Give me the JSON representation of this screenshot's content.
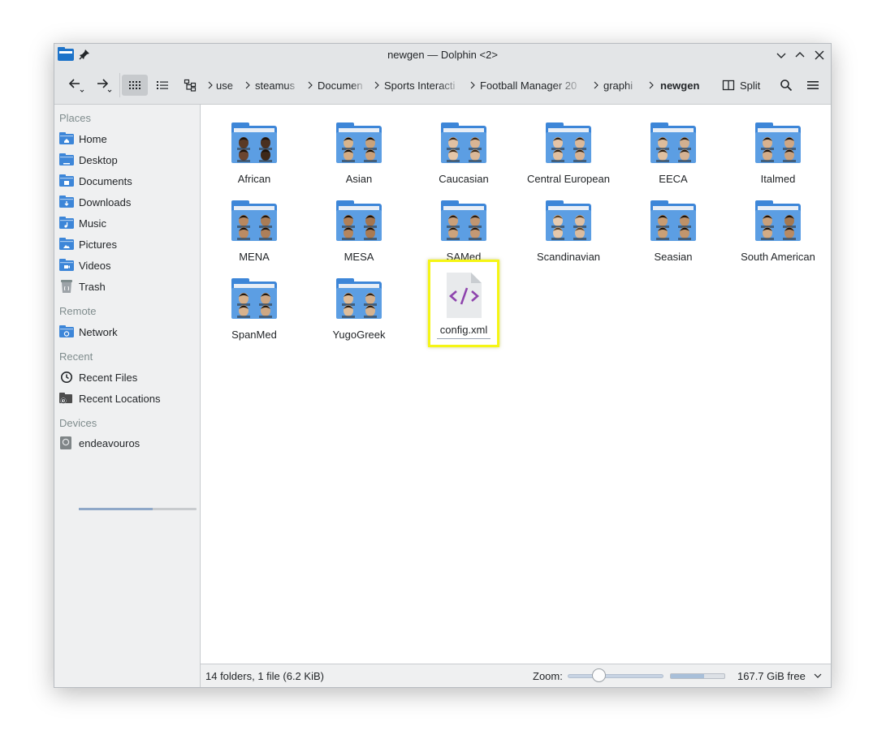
{
  "window": {
    "title": "newgen — Dolphin <2>"
  },
  "toolbar": {
    "breadcrumbs": [
      {
        "label": "use"
      },
      {
        "label": "steamus"
      },
      {
        "label": "Documen"
      },
      {
        "label": "Sports Interacti"
      },
      {
        "label": "Football Manager 20"
      },
      {
        "label": "graphi"
      },
      {
        "label": "newgen"
      }
    ],
    "split_label": "Split"
  },
  "sidebar": {
    "sections": {
      "places": "Places",
      "remote": "Remote",
      "recent": "Recent",
      "devices": "Devices"
    },
    "places": [
      {
        "label": "Home",
        "icon": "home-folder-icon"
      },
      {
        "label": "Desktop",
        "icon": "desktop-folder-icon"
      },
      {
        "label": "Documents",
        "icon": "documents-folder-icon"
      },
      {
        "label": "Downloads",
        "icon": "downloads-folder-icon"
      },
      {
        "label": "Music",
        "icon": "music-folder-icon"
      },
      {
        "label": "Pictures",
        "icon": "pictures-folder-icon"
      },
      {
        "label": "Videos",
        "icon": "videos-folder-icon"
      },
      {
        "label": "Trash",
        "icon": "trash-icon"
      }
    ],
    "remote": [
      {
        "label": "Network",
        "icon": "network-folder-icon"
      }
    ],
    "recent": [
      {
        "label": "Recent Files",
        "icon": "clock-icon"
      },
      {
        "label": "Recent Locations",
        "icon": "recent-locations-icon"
      }
    ],
    "devices": [
      {
        "label": "endeavouros",
        "icon": "drive-icon",
        "usage": 0.63
      }
    ]
  },
  "content": {
    "folders": [
      {
        "name": "African"
      },
      {
        "name": "Asian"
      },
      {
        "name": "Caucasian"
      },
      {
        "name": "Central European"
      },
      {
        "name": "EECA"
      },
      {
        "name": "Italmed"
      },
      {
        "name": "MENA"
      },
      {
        "name": "MESA"
      },
      {
        "name": "SAMed"
      },
      {
        "name": "Scandinavian"
      },
      {
        "name": "Seasian"
      },
      {
        "name": "South American"
      },
      {
        "name": "SpanMed"
      },
      {
        "name": "YugoGreek"
      }
    ],
    "files": [
      {
        "name": "config.xml",
        "icon": "xml-file-icon",
        "selected": true
      }
    ]
  },
  "statusbar": {
    "summary": "14 folders, 1 file (6.2 KiB)",
    "zoom_label": "Zoom:",
    "zoom_level": 0.3,
    "space_used": 0.62,
    "free_space": "167.7 GiB free"
  },
  "colors": {
    "folder_blue": "#3d86d8",
    "selection_highlight": "#f5f514",
    "xml_icon_purple": "#8e44ad"
  }
}
